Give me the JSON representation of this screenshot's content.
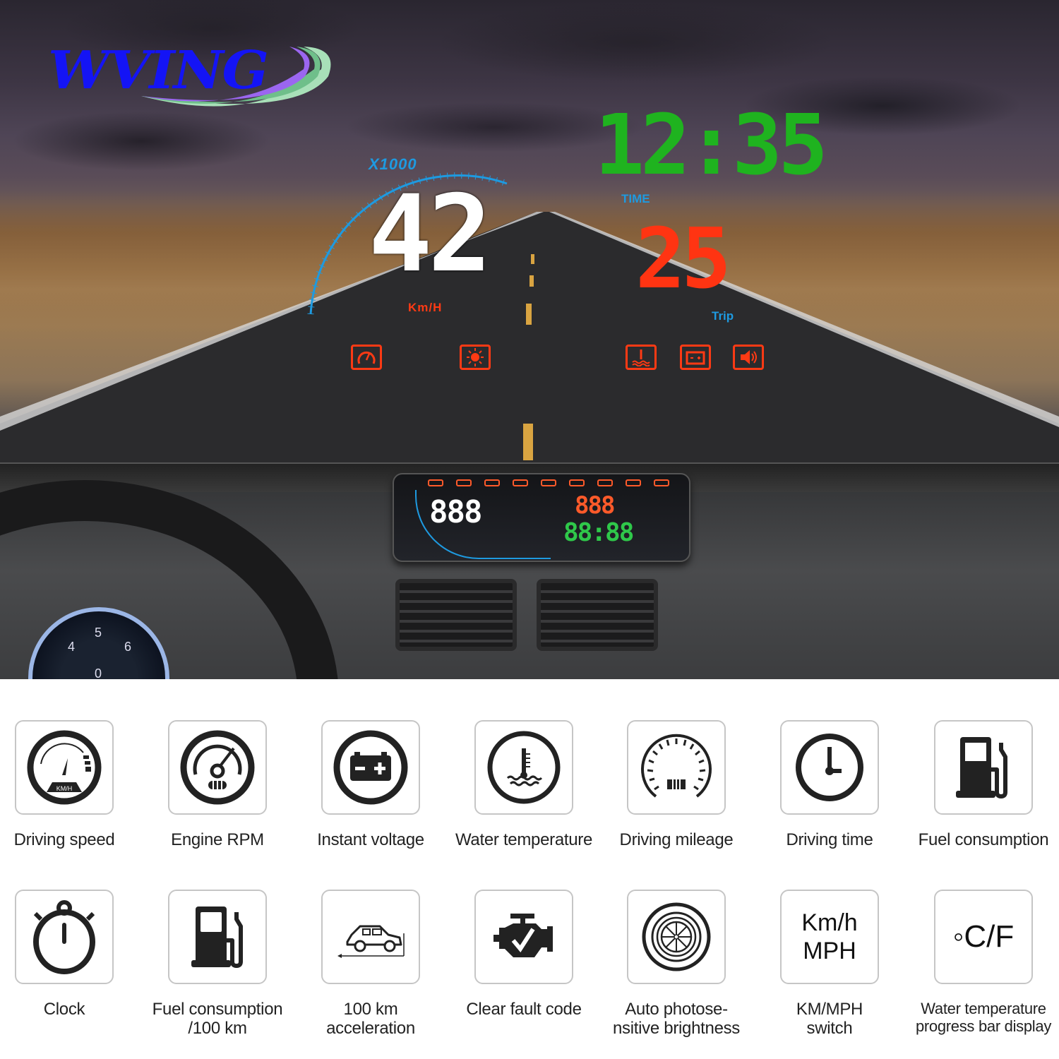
{
  "brand": {
    "logo_text": "WVING",
    "colors": {
      "text": "#1414f5",
      "swoosh_primary": "#9b66f0",
      "swoosh_secondary": "#6fbf8a"
    }
  },
  "hud_projection": {
    "rpm_scale_label": "X1000",
    "speed_value": "42",
    "speed_unit": "Km/H",
    "time_value": "12:35",
    "time_label": "TIME",
    "trip_value": "25",
    "trip_label": "Trip",
    "warning_icons": [
      "speedometer-icon",
      "brightness-icon",
      "water-temperature-icon",
      "battery-icon",
      "speaker-icon"
    ],
    "colors": {
      "speed": "#ffffff",
      "time": "#1fb31f",
      "trip": "#ff3412",
      "labels": "#1e9ae0",
      "warnings": "#ff3a14"
    }
  },
  "hud_device": {
    "speed_display": "888",
    "fuel_display": "888",
    "clock_display": "88:88"
  },
  "dashboard_gauge": {
    "ticks": [
      "0",
      "4",
      "5",
      "6"
    ]
  },
  "features": [
    {
      "icon": "speedometer-icon",
      "label": "Driving speed"
    },
    {
      "icon": "tachometer-icon",
      "label": "Engine RPM"
    },
    {
      "icon": "battery-icon",
      "label": "Instant voltage"
    },
    {
      "icon": "water-temperature-icon",
      "label": "Water temperature"
    },
    {
      "icon": "odometer-icon",
      "label": "Driving mileage"
    },
    {
      "icon": "clock-icon",
      "label": "Driving time"
    },
    {
      "icon": "fuel-pump-icon",
      "label": "Fuel consumption"
    },
    {
      "icon": "stopwatch-icon",
      "label": "Clock"
    },
    {
      "icon": "fuel-pump-icon",
      "label": "Fuel consumption\n/100 km"
    },
    {
      "icon": "car-acceleration-icon",
      "label": "100 km\nacceleration"
    },
    {
      "icon": "engine-check-icon",
      "label": "Clear fault code"
    },
    {
      "icon": "light-sensor-icon",
      "label": "Auto photose-\nnsitive brightness"
    },
    {
      "icon": "unit-switch-icon",
      "label": "KM/MPH\nswitch",
      "icon_text": "Km/h\nMPH"
    },
    {
      "icon": "temperature-unit-icon",
      "label": "Water temperature\nprogress bar display",
      "icon_text": "◦C/F"
    }
  ]
}
